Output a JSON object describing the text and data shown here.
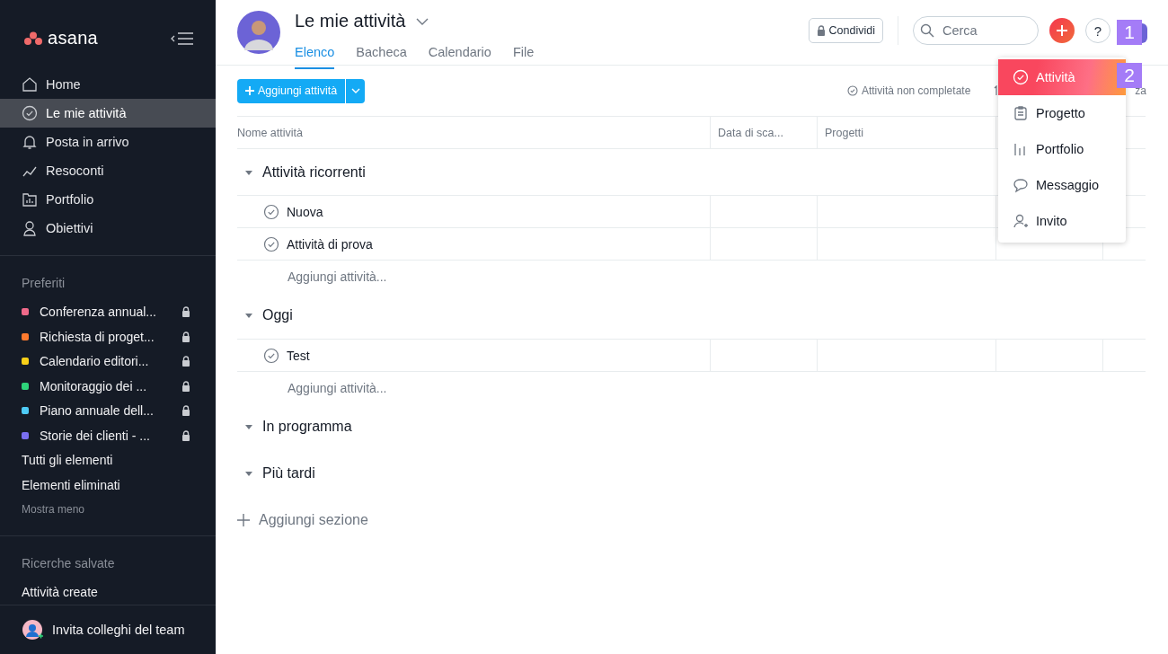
{
  "sidebar": {
    "logo": "asana",
    "nav": [
      {
        "label": "Home",
        "selected": false
      },
      {
        "label": "Le mie attività",
        "selected": true
      },
      {
        "label": "Posta in arrivo",
        "selected": false
      },
      {
        "label": "Resoconti",
        "selected": false
      },
      {
        "label": "Portfolio",
        "selected": false
      },
      {
        "label": "Obiettivi",
        "selected": false
      }
    ],
    "favorites_title": "Preferiti",
    "favorites": [
      {
        "label": "Conferenza annual...",
        "color": "#f06a8a"
      },
      {
        "label": "Richiesta di proget...",
        "color": "#fd7a2e"
      },
      {
        "label": "Calendario editori...",
        "color": "#f8d018"
      },
      {
        "label": "Monitoraggio dei ...",
        "color": "#2ed47a"
      },
      {
        "label": "Piano annuale dell...",
        "color": "#4ecbf6"
      },
      {
        "label": "Storie dei clienti - ...",
        "color": "#7a6ff0"
      }
    ],
    "links": [
      "Tutti gli elementi",
      "Elementi eliminati"
    ],
    "show_less": "Mostra meno",
    "saved_title": "Ricerche salvate",
    "saved": [
      "Attività create"
    ],
    "invite": "Invita colleghi del team"
  },
  "header": {
    "title": "Le mie attività",
    "tabs": [
      {
        "label": "Elenco",
        "selected": true
      },
      {
        "label": "Bacheca",
        "selected": false
      },
      {
        "label": "Calendario",
        "selected": false
      },
      {
        "label": "File",
        "selected": false
      }
    ],
    "share": "Condividi",
    "search": {
      "placeholder": "Cerca"
    },
    "help": "?"
  },
  "toolbar": {
    "add_task": "Aggiungi attività",
    "filter": "Attività non completate",
    "sort": "za"
  },
  "table": {
    "columns": [
      "Nome attività",
      "Data di sca...",
      "Progetti"
    ],
    "sections": [
      {
        "title": "Attività ricorrenti",
        "expanded": true,
        "tasks": [
          "Nuova",
          "Attività di prova"
        ],
        "add": "Aggiungi attività..."
      },
      {
        "title": "Oggi",
        "expanded": true,
        "tasks": [
          "Test"
        ],
        "add": "Aggiungi attività..."
      },
      {
        "title": "In programma",
        "expanded": true
      },
      {
        "title": "Più tardi",
        "expanded": true
      }
    ],
    "add_section": "Aggiungi sezione"
  },
  "menu": {
    "items": [
      {
        "label": "Attività",
        "selected": true
      },
      {
        "label": "Progetto",
        "selected": false
      },
      {
        "label": "Portfolio",
        "selected": false
      },
      {
        "label": "Messaggio",
        "selected": false
      },
      {
        "label": "Invito",
        "selected": false
      }
    ]
  },
  "markers": [
    "1",
    "2"
  ]
}
